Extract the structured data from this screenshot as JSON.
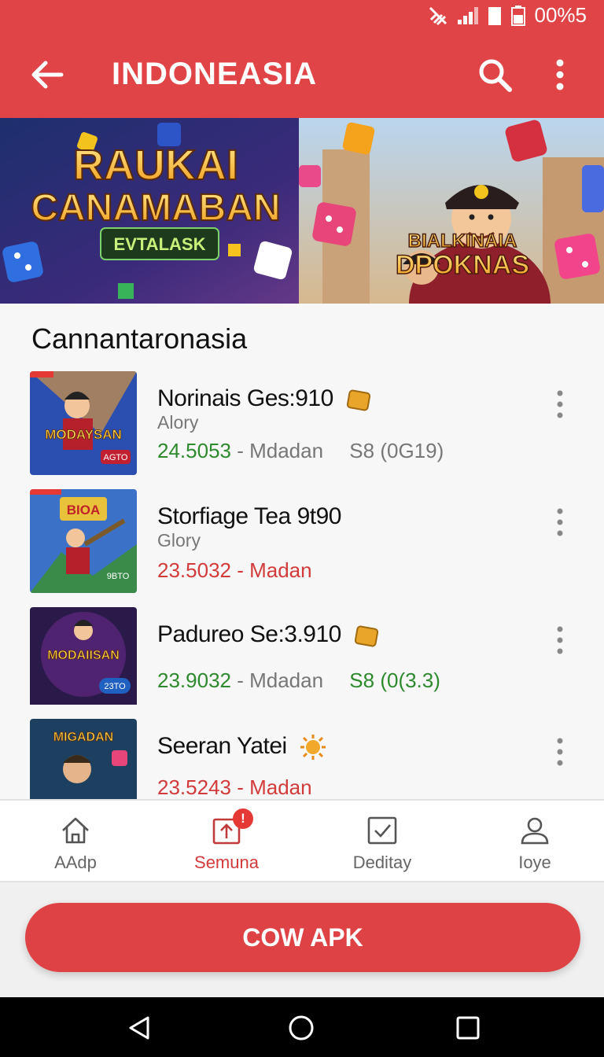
{
  "status_bar": {
    "battery_text": "00%5"
  },
  "app_bar": {
    "title": "INDONEASIA"
  },
  "banner": {
    "headline_line1": "RAUKAI",
    "headline_line2": "CANAMABAN",
    "ribbon": "EVTALASK",
    "right_line1": "BIALKINAIA",
    "right_line2": "DPOKNAS"
  },
  "section": {
    "title": "Cannantaronasia"
  },
  "games": [
    {
      "name": "Norinais Ges:910",
      "sub": "Alory",
      "value": "24.5053",
      "dev": "- Mdadan",
      "price": "S8 (0G19)",
      "thumb_text": "MODAYSAN",
      "thumb_tag": "AGTO"
    },
    {
      "name": "Storfiage Tea 9t90",
      "sub": "Glory",
      "value": "23.5032",
      "dev": "- Madan",
      "price": "",
      "thumb_text": "BIOA",
      "thumb_tag": "9BTO"
    },
    {
      "name": "Padureo Se:3.910",
      "sub": "",
      "value": "23.9032",
      "dev": "- Mdadan",
      "price": "S8 (0(3.3)",
      "thumb_text": "MODAIISAN",
      "thumb_tag": "23TO"
    },
    {
      "name": "Seeran Yatei",
      "sub": "",
      "value": "23.5243",
      "dev": "- Madan",
      "price": "",
      "thumb_text": "MIGADAN",
      "thumb_tag": ""
    }
  ],
  "bottom_nav": {
    "items": [
      {
        "label": "AAdp",
        "icon": "home-icon"
      },
      {
        "label": "Semuna",
        "icon": "upload-box-icon",
        "badge": "!"
      },
      {
        "label": "Deditay",
        "icon": "check-box-icon"
      },
      {
        "label": "Ioye",
        "icon": "profile-icon"
      }
    ]
  },
  "cta": {
    "label": "COW APK"
  },
  "colors": {
    "brand_red": "#e04446",
    "value_green": "#2d8a2d",
    "value_red": "#d33b3b"
  }
}
